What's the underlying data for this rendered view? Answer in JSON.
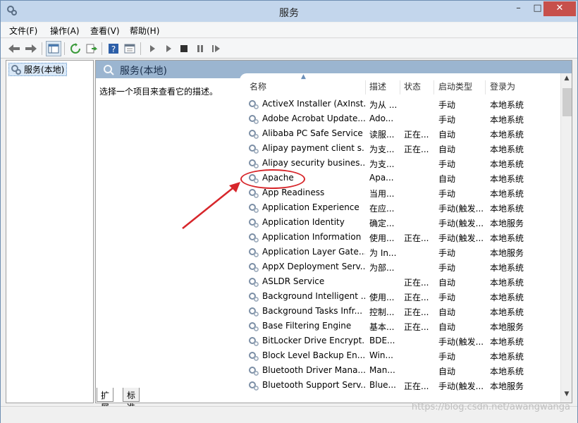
{
  "window": {
    "title": "服务",
    "min_glyph": "–",
    "max_glyph": "□",
    "close_glyph": "✕"
  },
  "menu": [
    "文件(F)",
    "操作(A)",
    "查看(V)",
    "帮助(H)"
  ],
  "tree": {
    "root_label": "服务(本地)"
  },
  "content": {
    "header_title": "服务(本地)",
    "description": "选择一个项目来查看它的描述。"
  },
  "columns": {
    "name": "名称",
    "desc": "描述",
    "status": "状态",
    "startup": "启动类型",
    "logon": "登录为"
  },
  "services": [
    {
      "name": "ActiveX Installer (AxInst...",
      "desc": "为从 ...",
      "status": "",
      "startup": "手动",
      "logon": "本地系统"
    },
    {
      "name": "Adobe Acrobat Update...",
      "desc": "Ado...",
      "status": "",
      "startup": "手动",
      "logon": "本地系统"
    },
    {
      "name": "Alibaba PC Safe Service",
      "desc": "读服...",
      "status": "正在...",
      "startup": "自动",
      "logon": "本地系统"
    },
    {
      "name": "Alipay payment client s...",
      "desc": "为支...",
      "status": "正在...",
      "startup": "自动",
      "logon": "本地系统"
    },
    {
      "name": "Alipay security busines...",
      "desc": "为支...",
      "status": "",
      "startup": "手动",
      "logon": "本地系统"
    },
    {
      "name": "Apache",
      "desc": "Apa...",
      "status": "",
      "startup": "自动",
      "logon": "本地系统"
    },
    {
      "name": "App Readiness",
      "desc": "当用...",
      "status": "",
      "startup": "手动",
      "logon": "本地系统"
    },
    {
      "name": "Application Experience",
      "desc": "在应...",
      "status": "",
      "startup": "手动(触发...",
      "logon": "本地系统"
    },
    {
      "name": "Application Identity",
      "desc": "确定...",
      "status": "",
      "startup": "手动(触发...",
      "logon": "本地服务"
    },
    {
      "name": "Application Information",
      "desc": "使用...",
      "status": "正在...",
      "startup": "手动(触发...",
      "logon": "本地系统"
    },
    {
      "name": "Application Layer Gate...",
      "desc": "为 In...",
      "status": "",
      "startup": "手动",
      "logon": "本地服务"
    },
    {
      "name": "AppX Deployment Serv...",
      "desc": "为部...",
      "status": "",
      "startup": "手动",
      "logon": "本地系统"
    },
    {
      "name": "ASLDR Service",
      "desc": "",
      "status": "正在...",
      "startup": "自动",
      "logon": "本地系统"
    },
    {
      "name": "Background Intelligent ...",
      "desc": "使用...",
      "status": "正在...",
      "startup": "手动",
      "logon": "本地系统"
    },
    {
      "name": "Background Tasks Infr...",
      "desc": "控制...",
      "status": "正在...",
      "startup": "自动",
      "logon": "本地系统"
    },
    {
      "name": "Base Filtering Engine",
      "desc": "基本...",
      "status": "正在...",
      "startup": "自动",
      "logon": "本地服务"
    },
    {
      "name": "BitLocker Drive Encrypt...",
      "desc": "BDE...",
      "status": "",
      "startup": "手动(触发...",
      "logon": "本地系统"
    },
    {
      "name": "Block Level Backup En...",
      "desc": "Win...",
      "status": "",
      "startup": "手动",
      "logon": "本地系统"
    },
    {
      "name": "Bluetooth Driver Mana...",
      "desc": "Man...",
      "status": "",
      "startup": "自动",
      "logon": "本地系统"
    },
    {
      "name": "Bluetooth Support Serv...",
      "desc": "Blue...",
      "status": "正在...",
      "startup": "手动(触发...",
      "logon": "本地服务"
    }
  ],
  "tabs": [
    "扩展",
    "标准"
  ],
  "watermark": "https://blog.csdn.net/awangwanga",
  "colors": {
    "titlebar": "#c3d6ec",
    "close_button": "#c7504b",
    "annotation": "#d7262b",
    "pane_header": "#9bb5d0"
  }
}
